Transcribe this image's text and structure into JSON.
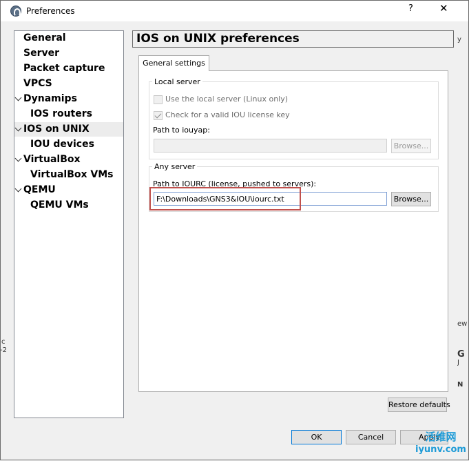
{
  "window": {
    "title": "Preferences",
    "help_label": "?",
    "close_label": "✕"
  },
  "nav": {
    "items": [
      {
        "label": "General"
      },
      {
        "label": "Server"
      },
      {
        "label": "Packet capture"
      },
      {
        "label": "VPCS"
      },
      {
        "label": "Dynamips"
      },
      {
        "label": "IOS routers"
      },
      {
        "label": "IOS on UNIX"
      },
      {
        "label": "IOU devices"
      },
      {
        "label": "VirtualBox"
      },
      {
        "label": "VirtualBox VMs"
      },
      {
        "label": "QEMU"
      },
      {
        "label": "QEMU VMs"
      }
    ],
    "selected": "IOS on UNIX"
  },
  "page": {
    "title": "IOS on UNIX preferences",
    "tab": "General settings",
    "local_server": {
      "title": "Local server",
      "use_local_label": "Use the local server (Linux only)",
      "use_local_checked": false,
      "check_license_label": "Check for a valid IOU license key",
      "check_license_checked": true,
      "iouyap_label": "Path to iouyap:",
      "iouyap_value": "",
      "browse_label": "Browse..."
    },
    "any_server": {
      "title": "Any server",
      "iourc_label": "Path to IOURC (license, pushed to servers):",
      "iourc_value": "F:\\Downloads\\GNS3&IOU\\iourc.txt",
      "browse_label": "Browse..."
    },
    "restore_label": "Restore defaults"
  },
  "footer": {
    "ok_label": "OK",
    "cancel_label": "Cancel",
    "apply_label": "Apply"
  },
  "watermark": {
    "line1": "活维网",
    "line2": "iyunv.com"
  },
  "background": {
    "right_top": "y",
    "right_mid": "ew",
    "right_g": "G",
    "right_j": "J",
    "right_n": "N",
    "left_c": "c",
    "left_dash": "-2"
  },
  "colors": {
    "highlight": "#c0504d",
    "focus": "#0078d7"
  }
}
